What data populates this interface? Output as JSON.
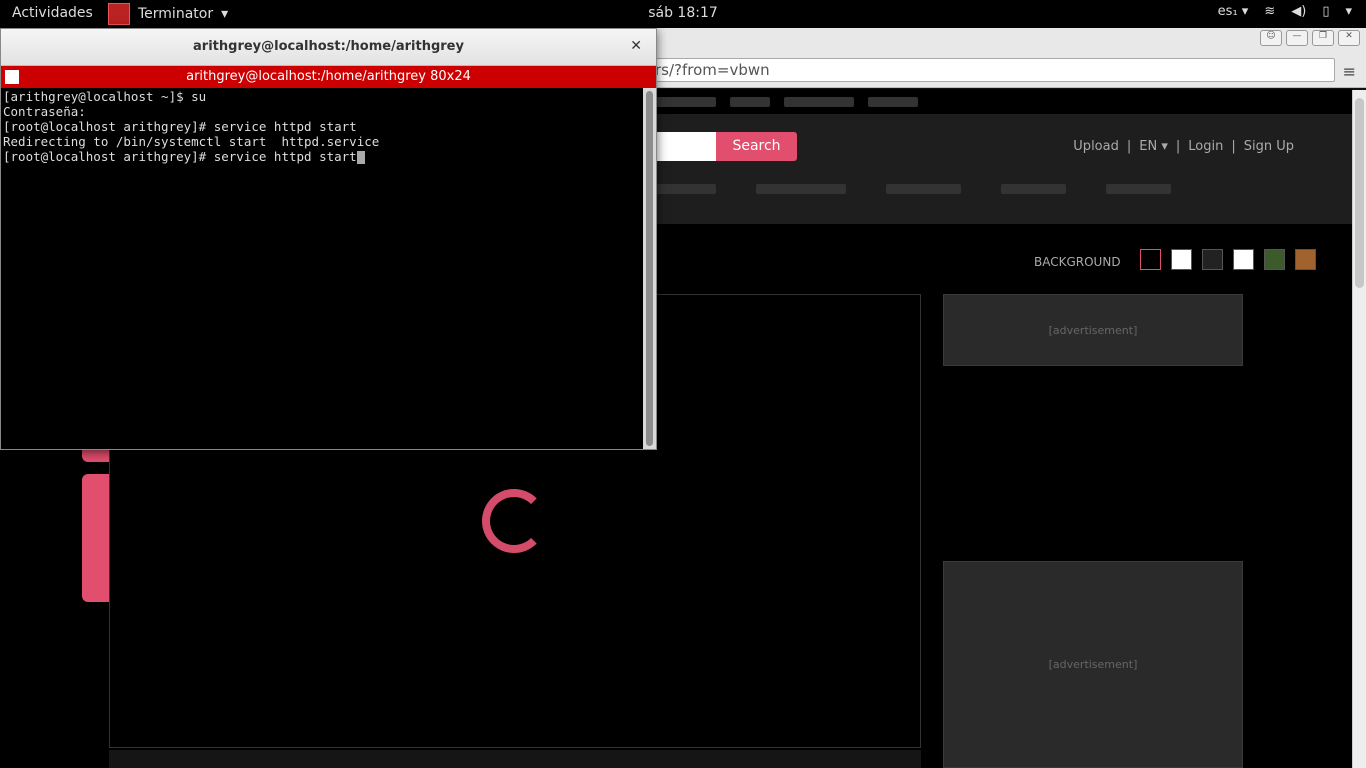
{
  "topbar": {
    "activities": "Actividades",
    "app_name": "Terminator",
    "clock": "sáb 18:17",
    "input_method": "es₁"
  },
  "terminator": {
    "window_title": "arithgrey@localhost:/home/arithgrey",
    "tab_title": "arithgrey@localhost:/home/arithgrey 80x24",
    "lines": [
      "[arithgrey@localhost ~]$ su",
      "Contraseña:",
      "[root@localhost arithgrey]# service httpd start",
      "Redirecting to /bin/systemctl start  httpd.service"
    ],
    "prompt_line": "[root@localhost arithgrey]# service httpd start"
  },
  "browser": {
    "url_fragment": "rs/?from=vbwn",
    "search_button": "Search",
    "account": {
      "upload": "Upload",
      "language": "EN",
      "login": "Login",
      "signup": "Sign Up"
    },
    "background_label": "BACKGROUND",
    "ad_placeholder_text": "[advertisement]"
  },
  "colors": {
    "terminal_tab_bg": "#cc0000",
    "site_accent": "#e14e6e"
  }
}
